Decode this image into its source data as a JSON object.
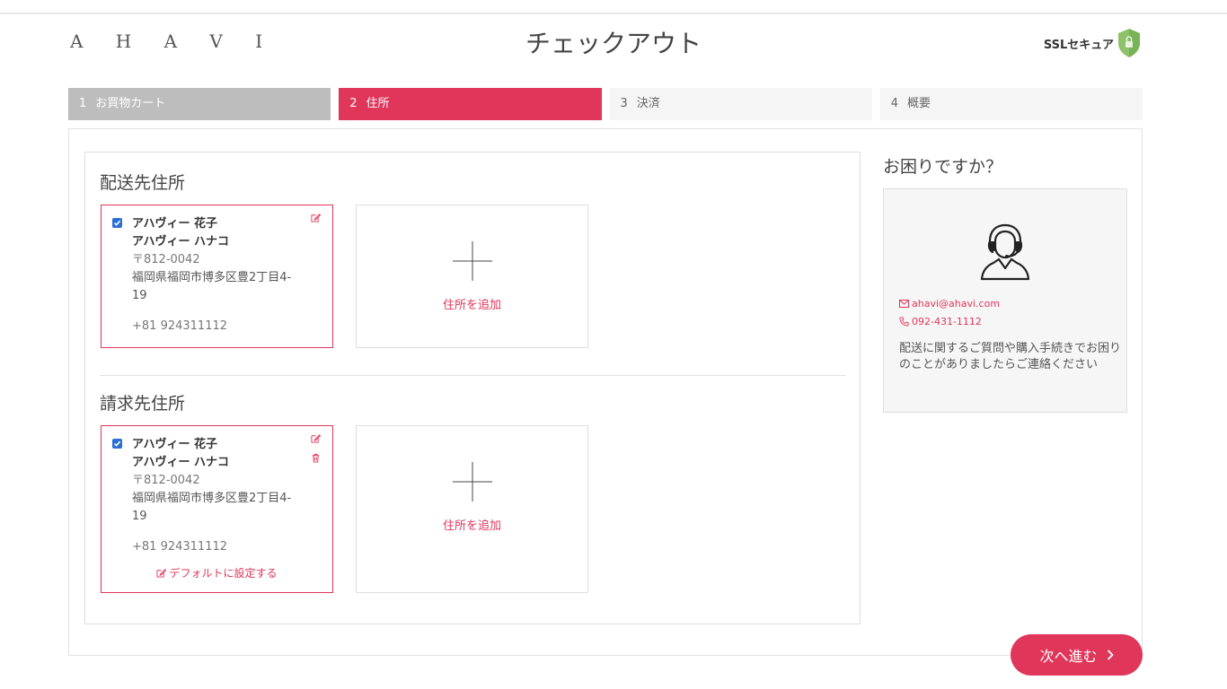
{
  "header": {
    "logo": "A H A V I",
    "title": "チェックアウト",
    "ssl_label": "SSLセキュア"
  },
  "steps": [
    {
      "num": "1",
      "label": "お買物カート"
    },
    {
      "num": "2",
      "label": "住所"
    },
    {
      "num": "3",
      "label": "決済"
    },
    {
      "num": "4",
      "label": "概要"
    }
  ],
  "shipping": {
    "title": "配送先住所",
    "address": {
      "name": "アハヴィー 花子",
      "name_kana": "アハヴィー ハナコ",
      "postal": "〒812-0042",
      "address_line1": "福岡県福岡市博多区豊2丁目4-",
      "address_line2": "19",
      "phone": "+81  924311112"
    },
    "add_label": "住所を追加"
  },
  "billing": {
    "title": "請求先住所",
    "address": {
      "name": "アハヴィー 花子",
      "name_kana": "アハヴィー ハナコ",
      "postal": "〒812-0042",
      "address_line1": "福岡県福岡市博多区豊2丁目4-",
      "address_line2": "19",
      "phone": "+81  924311112",
      "set_default": "デフォルトに設定する"
    },
    "add_label": "住所を追加"
  },
  "help": {
    "title": "お困りですか？",
    "email": "ahavi@ahavi.com",
    "phone": "092-431-1112",
    "text": "配送に関するご質問や購入手続きでお困りのことがありましたらご連絡ください"
  },
  "next_button": "次へ進む",
  "colors": {
    "accent": "#e0365a",
    "step_done": "#bdbdbd",
    "checkbox": "#2a6ed6",
    "shield": "#8dc26a"
  }
}
